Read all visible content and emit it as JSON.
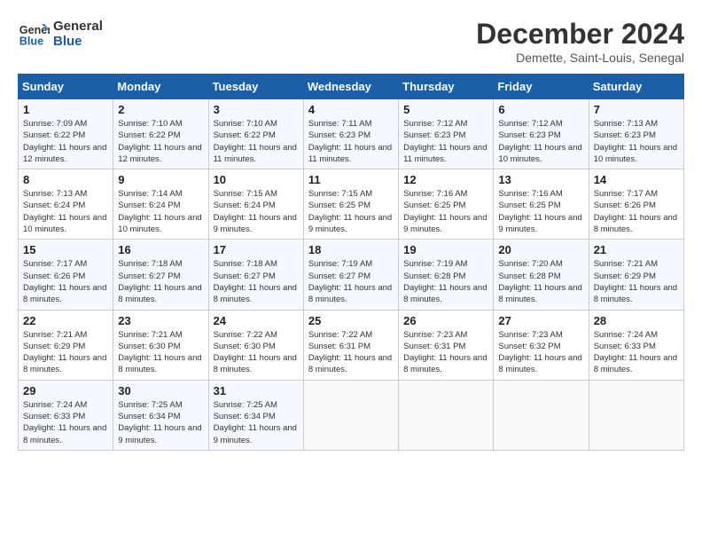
{
  "header": {
    "logo_line1": "General",
    "logo_line2": "Blue",
    "month": "December 2024",
    "location": "Demette, Saint-Louis, Senegal"
  },
  "weekdays": [
    "Sunday",
    "Monday",
    "Tuesday",
    "Wednesday",
    "Thursday",
    "Friday",
    "Saturday"
  ],
  "weeks": [
    [
      {
        "day": "1",
        "sunrise": "Sunrise: 7:09 AM",
        "sunset": "Sunset: 6:22 PM",
        "daylight": "Daylight: 11 hours and 12 minutes."
      },
      {
        "day": "2",
        "sunrise": "Sunrise: 7:10 AM",
        "sunset": "Sunset: 6:22 PM",
        "daylight": "Daylight: 11 hours and 12 minutes."
      },
      {
        "day": "3",
        "sunrise": "Sunrise: 7:10 AM",
        "sunset": "Sunset: 6:22 PM",
        "daylight": "Daylight: 11 hours and 11 minutes."
      },
      {
        "day": "4",
        "sunrise": "Sunrise: 7:11 AM",
        "sunset": "Sunset: 6:23 PM",
        "daylight": "Daylight: 11 hours and 11 minutes."
      },
      {
        "day": "5",
        "sunrise": "Sunrise: 7:12 AM",
        "sunset": "Sunset: 6:23 PM",
        "daylight": "Daylight: 11 hours and 11 minutes."
      },
      {
        "day": "6",
        "sunrise": "Sunrise: 7:12 AM",
        "sunset": "Sunset: 6:23 PM",
        "daylight": "Daylight: 11 hours and 10 minutes."
      },
      {
        "day": "7",
        "sunrise": "Sunrise: 7:13 AM",
        "sunset": "Sunset: 6:23 PM",
        "daylight": "Daylight: 11 hours and 10 minutes."
      }
    ],
    [
      {
        "day": "8",
        "sunrise": "Sunrise: 7:13 AM",
        "sunset": "Sunset: 6:24 PM",
        "daylight": "Daylight: 11 hours and 10 minutes."
      },
      {
        "day": "9",
        "sunrise": "Sunrise: 7:14 AM",
        "sunset": "Sunset: 6:24 PM",
        "daylight": "Daylight: 11 hours and 10 minutes."
      },
      {
        "day": "10",
        "sunrise": "Sunrise: 7:15 AM",
        "sunset": "Sunset: 6:24 PM",
        "daylight": "Daylight: 11 hours and 9 minutes."
      },
      {
        "day": "11",
        "sunrise": "Sunrise: 7:15 AM",
        "sunset": "Sunset: 6:25 PM",
        "daylight": "Daylight: 11 hours and 9 minutes."
      },
      {
        "day": "12",
        "sunrise": "Sunrise: 7:16 AM",
        "sunset": "Sunset: 6:25 PM",
        "daylight": "Daylight: 11 hours and 9 minutes."
      },
      {
        "day": "13",
        "sunrise": "Sunrise: 7:16 AM",
        "sunset": "Sunset: 6:25 PM",
        "daylight": "Daylight: 11 hours and 9 minutes."
      },
      {
        "day": "14",
        "sunrise": "Sunrise: 7:17 AM",
        "sunset": "Sunset: 6:26 PM",
        "daylight": "Daylight: 11 hours and 8 minutes."
      }
    ],
    [
      {
        "day": "15",
        "sunrise": "Sunrise: 7:17 AM",
        "sunset": "Sunset: 6:26 PM",
        "daylight": "Daylight: 11 hours and 8 minutes."
      },
      {
        "day": "16",
        "sunrise": "Sunrise: 7:18 AM",
        "sunset": "Sunset: 6:27 PM",
        "daylight": "Daylight: 11 hours and 8 minutes."
      },
      {
        "day": "17",
        "sunrise": "Sunrise: 7:18 AM",
        "sunset": "Sunset: 6:27 PM",
        "daylight": "Daylight: 11 hours and 8 minutes."
      },
      {
        "day": "18",
        "sunrise": "Sunrise: 7:19 AM",
        "sunset": "Sunset: 6:27 PM",
        "daylight": "Daylight: 11 hours and 8 minutes."
      },
      {
        "day": "19",
        "sunrise": "Sunrise: 7:19 AM",
        "sunset": "Sunset: 6:28 PM",
        "daylight": "Daylight: 11 hours and 8 minutes."
      },
      {
        "day": "20",
        "sunrise": "Sunrise: 7:20 AM",
        "sunset": "Sunset: 6:28 PM",
        "daylight": "Daylight: 11 hours and 8 minutes."
      },
      {
        "day": "21",
        "sunrise": "Sunrise: 7:21 AM",
        "sunset": "Sunset: 6:29 PM",
        "daylight": "Daylight: 11 hours and 8 minutes."
      }
    ],
    [
      {
        "day": "22",
        "sunrise": "Sunrise: 7:21 AM",
        "sunset": "Sunset: 6:29 PM",
        "daylight": "Daylight: 11 hours and 8 minutes."
      },
      {
        "day": "23",
        "sunrise": "Sunrise: 7:21 AM",
        "sunset": "Sunset: 6:30 PM",
        "daylight": "Daylight: 11 hours and 8 minutes."
      },
      {
        "day": "24",
        "sunrise": "Sunrise: 7:22 AM",
        "sunset": "Sunset: 6:30 PM",
        "daylight": "Daylight: 11 hours and 8 minutes."
      },
      {
        "day": "25",
        "sunrise": "Sunrise: 7:22 AM",
        "sunset": "Sunset: 6:31 PM",
        "daylight": "Daylight: 11 hours and 8 minutes."
      },
      {
        "day": "26",
        "sunrise": "Sunrise: 7:23 AM",
        "sunset": "Sunset: 6:31 PM",
        "daylight": "Daylight: 11 hours and 8 minutes."
      },
      {
        "day": "27",
        "sunrise": "Sunrise: 7:23 AM",
        "sunset": "Sunset: 6:32 PM",
        "daylight": "Daylight: 11 hours and 8 minutes."
      },
      {
        "day": "28",
        "sunrise": "Sunrise: 7:24 AM",
        "sunset": "Sunset: 6:33 PM",
        "daylight": "Daylight: 11 hours and 8 minutes."
      }
    ],
    [
      {
        "day": "29",
        "sunrise": "Sunrise: 7:24 AM",
        "sunset": "Sunset: 6:33 PM",
        "daylight": "Daylight: 11 hours and 8 minutes."
      },
      {
        "day": "30",
        "sunrise": "Sunrise: 7:25 AM",
        "sunset": "Sunset: 6:34 PM",
        "daylight": "Daylight: 11 hours and 9 minutes."
      },
      {
        "day": "31",
        "sunrise": "Sunrise: 7:25 AM",
        "sunset": "Sunset: 6:34 PM",
        "daylight": "Daylight: 11 hours and 9 minutes."
      },
      null,
      null,
      null,
      null
    ]
  ]
}
